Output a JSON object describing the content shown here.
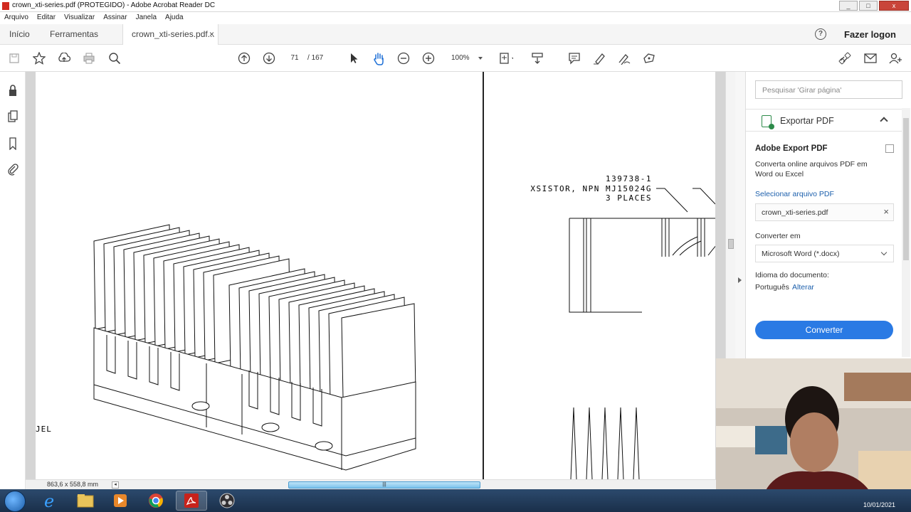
{
  "window": {
    "title": "crown_xti-series.pdf (PROTEGIDO) - Adobe Acrobat Reader DC"
  },
  "menu": [
    "Arquivo",
    "Editar",
    "Visualizar",
    "Assinar",
    "Janela",
    "Ajuda"
  ],
  "tabs": {
    "home": "Início",
    "tools": "Ferramentas",
    "doc": "crown_xti-series.pdf...",
    "close": "×"
  },
  "header": {
    "help": "?",
    "login": "Fazer logon"
  },
  "toolbar": {
    "page_current": "71",
    "page_sep": "/",
    "page_total": "167",
    "zoom": "100%"
  },
  "document": {
    "callout_line1": "139738-1",
    "callout_line2": "XSISTOR, NPN MJ15024G",
    "callout_line3": "3 PLACES",
    "left_fragment": "JEL"
  },
  "status": {
    "page_size": "863,6 x 558,8 mm",
    "scroll_grip": "|||"
  },
  "panel": {
    "search_placeholder": "Pesquisar 'Girar página'",
    "export_header": "Exportar PDF",
    "export_title": "Adobe Export PDF",
    "export_desc": "Converta online arquivos PDF em Word ou Excel",
    "select_link": "Selecionar arquivo PDF",
    "file_name": "crown_xti-series.pdf",
    "file_clear": "×",
    "convert_label": "Converter em",
    "format": "Microsoft Word (*.docx)",
    "language_label": "Idioma do documento:",
    "language": "Português",
    "language_change": "Alterar",
    "convert_button": "Converter"
  },
  "taskbar": {
    "clock": "10/01/2021"
  },
  "colors": {
    "accent": "#2a7ae4",
    "link": "#1c5fac",
    "export_icon": "#2d8b4a"
  },
  "icons": [
    "save-icon",
    "star-icon",
    "upload-icon",
    "print-icon",
    "zoom-search-icon",
    "page-up-icon",
    "page-down-icon",
    "select-cursor-icon",
    "hand-icon",
    "zoom-out-icon",
    "zoom-in-icon",
    "fit-page-icon",
    "scroll-mode-icon",
    "comment-icon",
    "highlight-icon",
    "sign-icon",
    "stamp-icon",
    "link-icon",
    "mail-icon",
    "add-user-icon",
    "lock-icon",
    "pages-icon",
    "bookmark-icon",
    "attachment-icon"
  ]
}
